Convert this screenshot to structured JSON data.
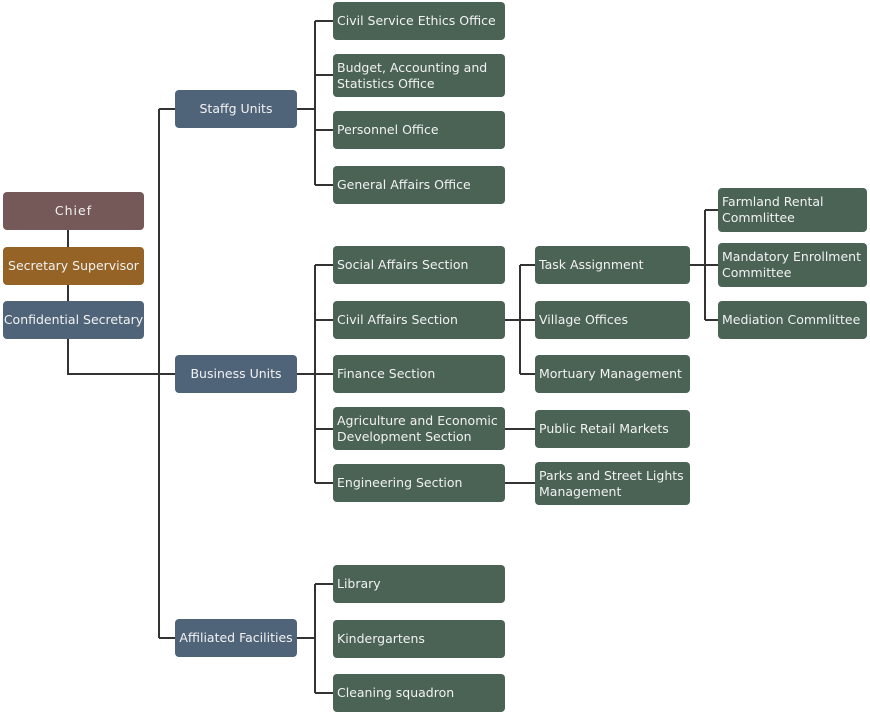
{
  "colors": {
    "chief": "#755858",
    "supervisor": "#956325",
    "unit": "#506479",
    "section": "#4a6354",
    "line": "#333333"
  },
  "leadership": {
    "chief": "Chief",
    "supervisor": "Secretary Supervisor",
    "confidential": "Confidential Secretary"
  },
  "units": {
    "staff": "Staffg Units",
    "business": "Business Units",
    "affiliated": "Affiliated Facilities"
  },
  "staff_offices": [
    "Civil Service Ethics Office",
    "Budget, Accounting and Statistics Office",
    "Personnel Office",
    "General Affairs Office"
  ],
  "business_sections": [
    "Social Affairs Section",
    "Civil Affairs Section",
    "Finance Section",
    "Agriculture and Economic Development Section",
    "Engineering Section"
  ],
  "civil_affairs_subs": [
    "Task Assignment",
    "Village Offices",
    "Mortuary Management"
  ],
  "agriculture_sub": "Public Retail Markets",
  "engineering_sub": "Parks and Street Lights Management",
  "task_committees": [
    "Farmland Rental Commlittee",
    "Mandatory Enrollment Committee",
    "Mediation Commlittee"
  ],
  "facilities": [
    "Library",
    "Kindergartens",
    "Cleaning squadron"
  ]
}
